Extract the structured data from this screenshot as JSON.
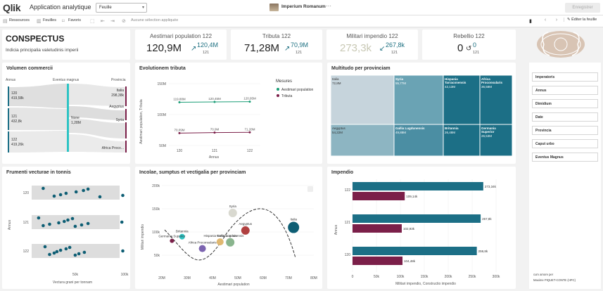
{
  "topbar": {
    "logo": "Qlik",
    "app_title": "Application analytique",
    "sheet_selector": "Feuille",
    "center_title": "Imperium Romanum",
    "more": "···",
    "save_label": "Enregistrer"
  },
  "toolbar": {
    "resources": "Ressources",
    "sheets": "Feuilles",
    "favorites": "Favoris",
    "no_selection": "Aucune sélection appliquée",
    "edit_sheet": "Éditer la feuille"
  },
  "header": {
    "title": "CONSPECTUS",
    "subtitle": "Indicia principalia valetudinis imperii"
  },
  "kpis": [
    {
      "title": "Aestimari population 122",
      "value": "120,9M",
      "arrow": "↗",
      "delta": "120,4M",
      "year": "121",
      "faded": false
    },
    {
      "title": "Tributa 122",
      "value": "71,28M",
      "arrow": "↗",
      "delta": "70,9M",
      "year": "121",
      "faded": false
    },
    {
      "title": "Militari impendio 122",
      "value": "273,3k",
      "arrow": "↙",
      "delta": "267,8k",
      "year": "121",
      "faded": true
    },
    {
      "title": "Rebellio 122",
      "value": "0",
      "arrow": "↺",
      "delta": "0",
      "year": "121",
      "faded": false
    }
  ],
  "sankey": {
    "title": "Volumen commercii",
    "col_headers": [
      "Annus",
      "Eventus magnus",
      "Provincia"
    ],
    "years": [
      {
        "label": "120",
        "value": "419,58k"
      },
      {
        "label": "121",
        "value": "432,8k"
      },
      {
        "label": "122",
        "value": "419,26k"
      }
    ],
    "event": {
      "label": "None",
      "value": "1,28M"
    },
    "provinces": [
      {
        "label": "Italia",
        "value": "298,38k"
      },
      {
        "label": "Aegyptus",
        "value": ""
      },
      {
        "label": "Syria",
        "value": ""
      },
      {
        "label": "Africa Proco...",
        "value": ""
      }
    ]
  },
  "line_chart": {
    "title": "Evolutionem tributa",
    "legend_title": "Mesures",
    "chart_data": {
      "type": "line",
      "categories": [
        "120",
        "121",
        "122"
      ],
      "series": [
        {
          "name": "Aestimari population",
          "values": [
            119.88,
            120.45,
            120.95
          ],
          "labels": [
            "119,88M",
            "120,45M",
            "120,95M"
          ],
          "color": "#1b9e77"
        },
        {
          "name": "Tributa",
          "values": [
            70.09,
            70.9,
            71.28
          ],
          "labels": [
            "70,09M",
            "70,9M",
            "71,28M"
          ],
          "color": "#7b1f49"
        }
      ],
      "xlabel": "Annus",
      "ylabel": "Aestimari population, Tributa",
      "yticks": [
        "150M",
        "100M",
        "50M"
      ],
      "ylim": [
        50,
        150
      ]
    }
  },
  "treemap": {
    "title": "Multitudo per provinciam",
    "cells": [
      {
        "label": "Italia",
        "value": "72,8M",
        "color": "#c6d4dc"
      },
      {
        "label": "Syria",
        "value": "55,77M",
        "color": "#6aa3b4"
      },
      {
        "label": "Hispania Tarraconensis",
        "value": "42,13M",
        "color": "#1c6f86"
      },
      {
        "label": "Africa Proconsularis",
        "value": "36,58M",
        "color": "#1c6f86"
      },
      {
        "label": "Aegyptus",
        "value": "54,22M",
        "color": "#8db5c2"
      },
      {
        "label": "Gallia Lugdunensis",
        "value": "49,88M",
        "color": "#4b8ea3"
      },
      {
        "label": "Britannia",
        "value": "26,48M",
        "color": "#1c6f86"
      },
      {
        "label": "Germania Superior",
        "value": "26,53M",
        "color": "#1c6f86"
      }
    ]
  },
  "dotplot": {
    "title": "Frumenti vecturae in tonnis",
    "chart_data": {
      "type": "scatter",
      "categories": [
        "120",
        "121",
        "122"
      ],
      "x": [
        [
          8,
          20,
          27,
          33,
          44,
          52,
          57,
          70,
          95
        ],
        [
          3,
          8,
          15,
          25,
          31,
          35,
          40,
          43,
          50,
          57,
          94
        ],
        [
          10,
          15,
          20,
          23,
          27,
          33,
          37,
          43,
          47,
          53,
          95
        ]
      ],
      "xlabel": "Vectura grani per tonnam",
      "ylabel": "Annus",
      "xticks": [
        "50k",
        "100k"
      ]
    }
  },
  "bubble": {
    "title": "Incolae, sumptus et vectigalia per provinciam",
    "chart_data": {
      "type": "scatter",
      "points": [
        {
          "label": "Syria",
          "x": 48,
          "y": 150,
          "r": 6,
          "color": "#d9d9d0"
        },
        {
          "label": "Aegyptus",
          "x": 53,
          "y": 116,
          "r": 6,
          "color": "#b04040"
        },
        {
          "label": "Italia",
          "x": 72,
          "y": 122,
          "r": 8,
          "color": "#0e5e74"
        },
        {
          "label": "Britannia",
          "x": 28,
          "y": 104,
          "r": 4,
          "color": "#2ec4c4"
        },
        {
          "label": "Germania Superior",
          "x": 24,
          "y": 96,
          "r": 3,
          "color": "#7b1f49"
        },
        {
          "label": "Hispania Tarraconensis",
          "x": 43,
          "y": 94,
          "r": 5,
          "color": "#e0b870"
        },
        {
          "label": "Gallia Lugdunensis",
          "x": 47,
          "y": 93,
          "r": 6,
          "color": "#8ab58e"
        },
        {
          "label": "Africa Proconsularis",
          "x": 36,
          "y": 81,
          "r": 5,
          "color": "#7c64b0"
        }
      ],
      "xlabel": "Aestimari population",
      "ylabel": "Militari impendio",
      "xticks": [
        "20M",
        "30M",
        "40M",
        "50M",
        "60M",
        "70M",
        "80M"
      ],
      "yticks": [
        "200k",
        "150k",
        "100k",
        "50k"
      ]
    }
  },
  "barchart": {
    "title": "Impendio",
    "chart_data": {
      "type": "bar",
      "categories": [
        "122",
        "121",
        "120"
      ],
      "series": [
        {
          "name": "Militari impendio",
          "values": [
            273.3,
            267.8,
            259.8
          ],
          "labels": [
            "273,34k",
            "267,8k",
            "259,8k"
          ],
          "color": "#1c6f86"
        },
        {
          "name": "Constructio impendio",
          "values": [
            109.14,
            102.93,
            104.48
          ],
          "labels": [
            "109,14k",
            "102,93k",
            "104,48k"
          ],
          "color": "#7b1f49"
        }
      ],
      "xlabel": "Militari impendio, Constructio impendio",
      "ylabel": "Annus",
      "xticks": [
        "0",
        "50k",
        "100k",
        "150k",
        "200k",
        "250k",
        "300k"
      ]
    }
  },
  "filters": [
    "Imperatoris",
    "Annus",
    "Dimidium",
    "Date",
    "Provincia",
    "Caput urbo",
    "Eventus Magnus"
  ],
  "footer": {
    "line1": "cum amore per",
    "line2": "Maxime PIQUET-CONTE (HPC)"
  }
}
